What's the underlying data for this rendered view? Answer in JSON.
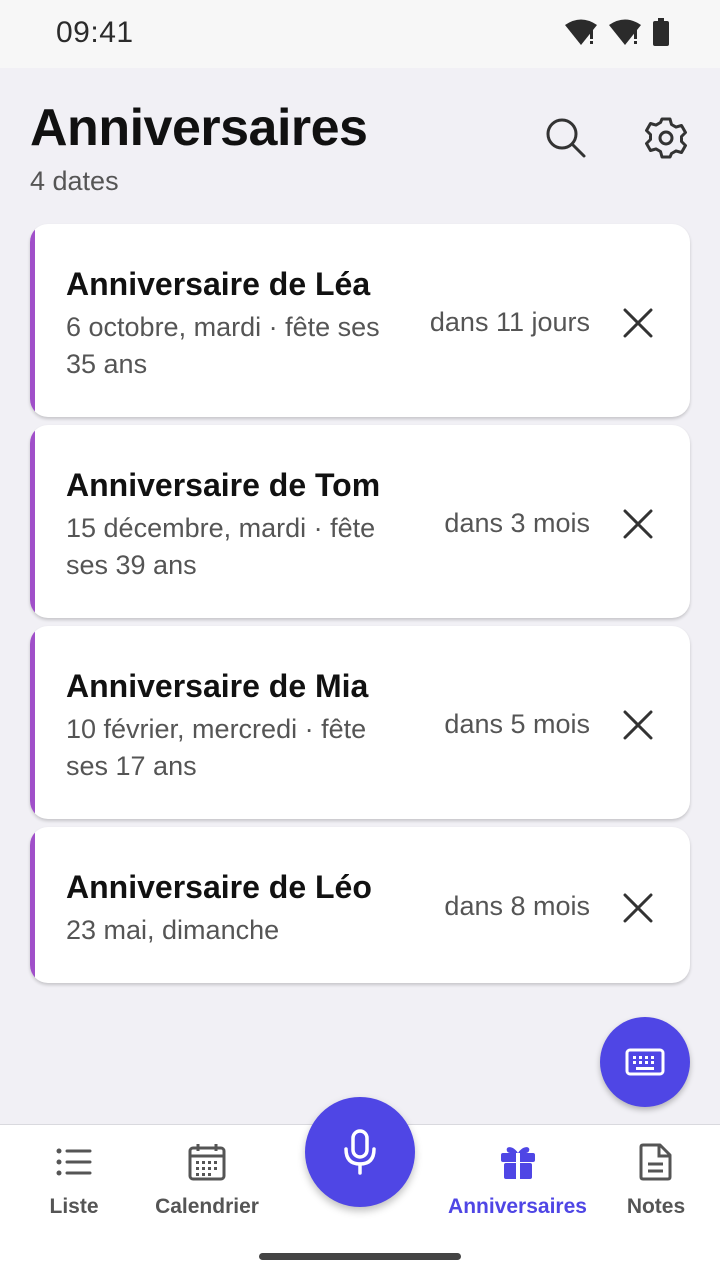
{
  "status_bar": {
    "time": "09:41"
  },
  "header": {
    "title": "Anniversaires",
    "subtitle": "4 dates"
  },
  "birthdays": [
    {
      "title": "Anniversaire de Léa",
      "subtitle": "6 octobre, mardi · fête ses 35 ans",
      "relative": "dans 11 jours"
    },
    {
      "title": "Anniversaire de Tom",
      "subtitle": "15 décembre, mardi · fête ses 39 ans",
      "relative": "dans 3 mois"
    },
    {
      "title": "Anniversaire de Mia",
      "subtitle": "10 février, mercredi · fête ses 17 ans",
      "relative": "dans 5 mois"
    },
    {
      "title": "Anniversaire de Léo",
      "subtitle": "23 mai, dimanche",
      "relative": "dans 8 mois"
    }
  ],
  "bottom_nav": {
    "items": [
      {
        "label": "Liste",
        "icon": "list-icon"
      },
      {
        "label": "Calendrier",
        "icon": "calendar-icon"
      },
      {
        "label": "Anniversaires",
        "icon": "gift-icon",
        "active": true
      },
      {
        "label": "Notes",
        "icon": "note-icon"
      }
    ]
  },
  "colors": {
    "accent": "#4f46e5",
    "card_stripe": "#a04fc9",
    "background": "#f1f0f5"
  }
}
